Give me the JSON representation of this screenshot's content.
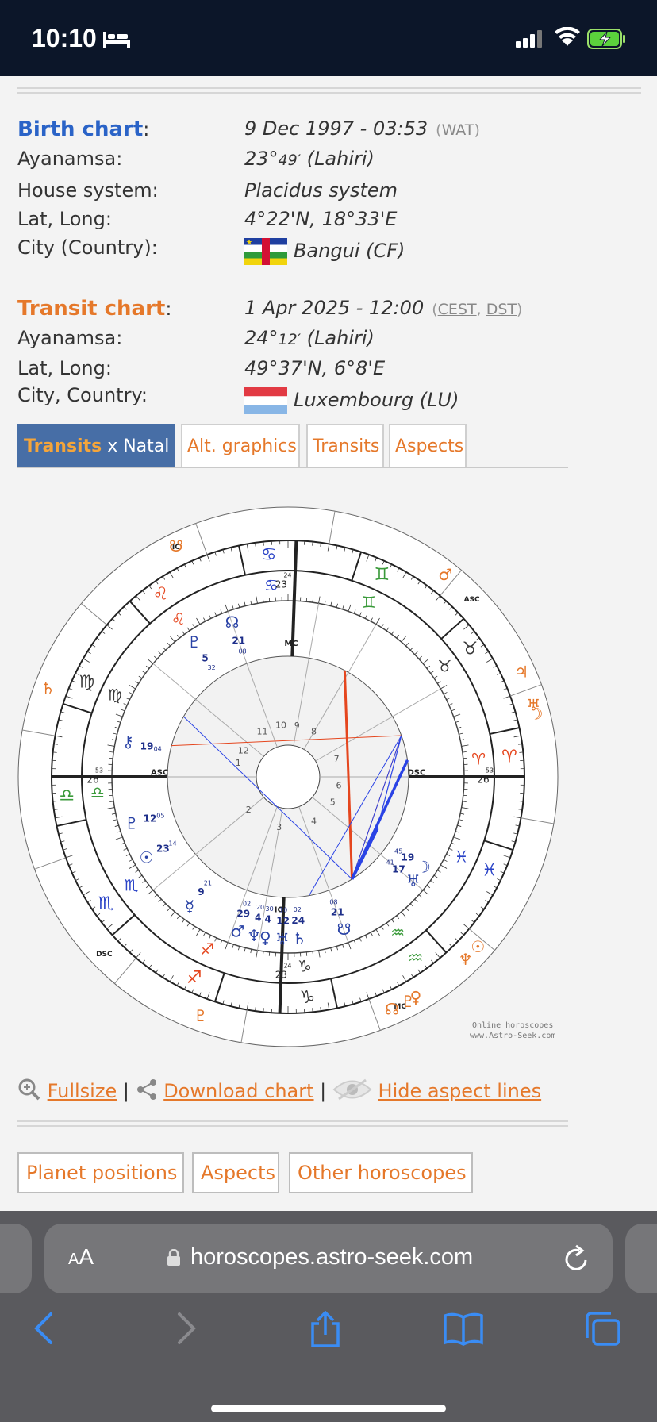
{
  "status_bar": {
    "time": "10:10",
    "icons": [
      "sleep-bed-icon",
      "signal-icon",
      "wifi-icon",
      "battery-charging-icon"
    ]
  },
  "birth": {
    "title": "Birth chart",
    "date": "9 Dec 1997 - 03:53",
    "tz": "WAT",
    "ayanamsa_label": "Ayanamsa:",
    "ayanamsa_deg": "23°",
    "ayanamsa_min": "49′",
    "ayanamsa_sys": " (Lahiri)",
    "house_label": "House system:",
    "house": "Placidus system",
    "latlong_label": "Lat, Long:",
    "latlong": "4°22'N, 18°33'E",
    "city_label": "City (Country):",
    "city": "Bangui (CF)"
  },
  "transit": {
    "title": "Transit chart",
    "date": "1 Apr 2025 - 12:00",
    "tz1": "CEST",
    "tz2": "DST",
    "ayanamsa_label": "Ayanamsa:",
    "ayanamsa_deg": "24°",
    "ayanamsa_min": "12′",
    "ayanamsa_sys": " (Lahiri)",
    "latlong_label": "Lat, Long:",
    "latlong": "49°37'N, 6°8'E",
    "city_label": "City, Country:",
    "city": "Luxembourg (LU)"
  },
  "tabs": [
    {
      "bold": "Transits",
      "rest": " x Natal",
      "active": true
    },
    {
      "label": "Alt. graphics"
    },
    {
      "label": "Transits"
    },
    {
      "label": "Aspects"
    }
  ],
  "chart": {
    "house_numbers": [
      "10",
      "9",
      "8",
      "7",
      "6",
      "5",
      "4",
      "3",
      "2",
      "1",
      "12",
      "11"
    ],
    "angles": {
      "mc": "MC",
      "asc": "ASC",
      "dsc": "DSC",
      "ic": "IC"
    },
    "outer_angles": {
      "ic": "IC",
      "asc": "ASC",
      "dsc": "DSC",
      "mc": "MC"
    },
    "house_cusps": [
      {
        "deg": "23",
        "min": "24"
      },
      {
        "deg": "26",
        "min": "53"
      },
      {
        "deg": "23",
        "min": "24"
      },
      {
        "deg": "26",
        "min": "53"
      }
    ],
    "natal_planets": [
      {
        "deg": "21",
        "min": "08"
      },
      {
        "deg": "5",
        "min": "32"
      },
      {
        "deg": "19",
        "min": "04"
      },
      {
        "deg": "12",
        "min": "05"
      },
      {
        "deg": "23",
        "min": "14"
      },
      {
        "deg": "9",
        "min": "21"
      },
      {
        "deg": "29",
        "min": "02"
      },
      {
        "deg": "4",
        "min": "20"
      },
      {
        "deg": "4",
        "min": "30"
      },
      {
        "deg": "12",
        "min": "10"
      },
      {
        "deg": "24",
        "min": "02"
      },
      {
        "deg": "21",
        "min": "08"
      },
      {
        "deg": "17",
        "min": "41"
      },
      {
        "deg": "19",
        "min": "45"
      }
    ],
    "credit_line1": "Online horoscopes",
    "credit_line2": "www.Astro-Seek.com",
    "colors": {
      "fire": "#e5461e",
      "earth": "#3a3a3a",
      "air": "#3a9a3a",
      "water": "#2a43c7",
      "natal": "#2a43a6",
      "transit": "#e5782a"
    }
  },
  "links": {
    "fullsize": "Fullsize",
    "download": "Download chart",
    "hide": "Hide aspect lines",
    "sep": " | "
  },
  "buttons": [
    "Planet positions",
    "Aspects",
    "Other horoscopes"
  ],
  "browser": {
    "aa_small": "A",
    "aa_large": "A",
    "url": "horoscopes.astro-seek.com"
  }
}
